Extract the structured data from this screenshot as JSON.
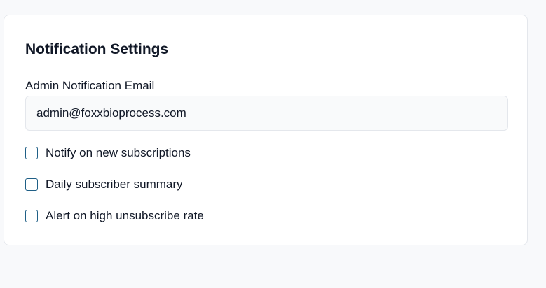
{
  "notification_settings": {
    "title": "Notification Settings",
    "admin_email": {
      "label": "Admin Notification Email",
      "value": "admin@foxxbioprocess.com"
    },
    "options": [
      {
        "label": "Notify on new subscriptions",
        "checked": false
      },
      {
        "label": "Daily subscriber summary",
        "checked": false
      },
      {
        "label": "Alert on high unsubscribe rate",
        "checked": false
      }
    ]
  },
  "colors": {
    "checkbox_border": "#1f5f86",
    "input_background": "#f9fafb",
    "border": "#e4e7ec"
  }
}
